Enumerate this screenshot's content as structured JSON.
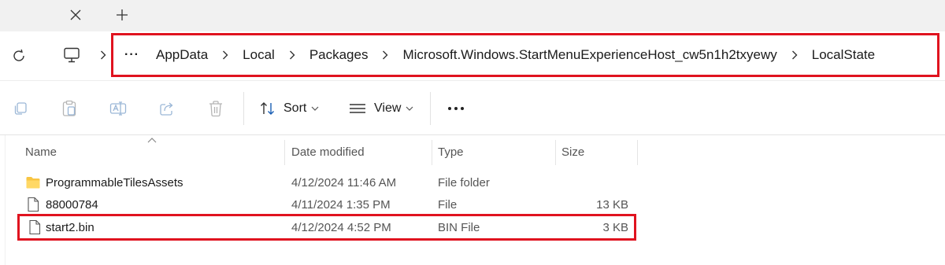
{
  "tabs": {
    "close_glyph": "✕",
    "new_tab_glyph": "+"
  },
  "address_bar": {
    "overflow_label": "···",
    "crumbs": [
      "AppData",
      "Local",
      "Packages",
      "Microsoft.Windows.StartMenuExperienceHost_cw5n1h2txyewy",
      "LocalState"
    ],
    "highlight_color": "#e0131f"
  },
  "command_bar": {
    "sort_label": "Sort",
    "view_label": "View",
    "icons": [
      "copy-icon",
      "paste-icon",
      "rename-icon",
      "share-icon",
      "delete-icon"
    ]
  },
  "file_list": {
    "columns": {
      "name": "Name",
      "date": "Date modified",
      "type": "Type",
      "size": "Size"
    },
    "rows": [
      {
        "name": "ProgrammableTilesAssets",
        "date": "4/12/2024 11:46 AM",
        "type": "File folder",
        "size": "",
        "icon": "folder-icon"
      },
      {
        "name": "88000784",
        "date": "4/11/2024 1:35 PM",
        "type": "File",
        "size": "13 KB",
        "icon": "file-icon"
      },
      {
        "name": "start2.bin",
        "date": "4/12/2024 4:52 PM",
        "type": "BIN File",
        "size": "3 KB",
        "icon": "file-icon",
        "highlighted": true
      }
    ]
  }
}
